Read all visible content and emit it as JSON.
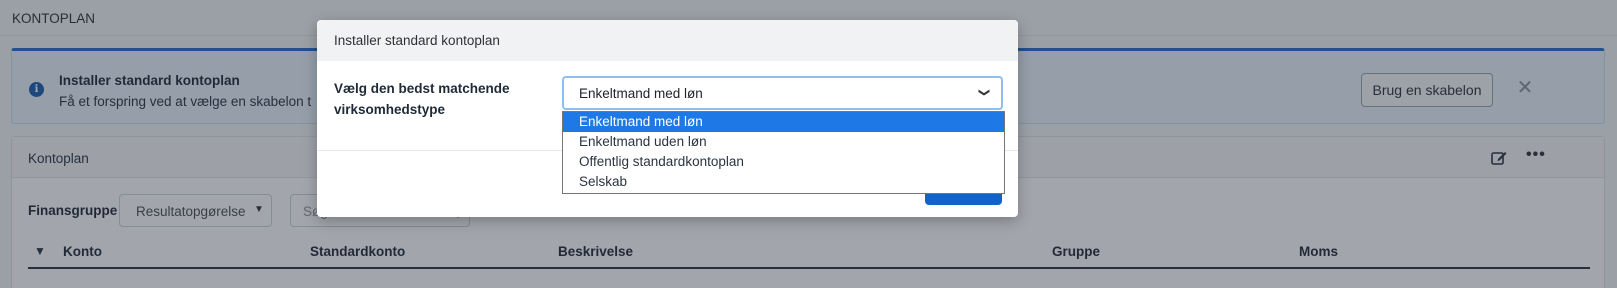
{
  "page": {
    "title": "KONTOPLAN"
  },
  "info": {
    "title": "Installer standard kontoplan",
    "text": "Få et forspring ved at vælge en skabelon t",
    "template_button": "Brug en skabelon",
    "close_glyph": "✕"
  },
  "card": {
    "title": "Kontoplan",
    "filter_label": "Finansgruppe",
    "group_select_value": "Resultatopgørelse",
    "search_placeholder": "Søg",
    "columns": [
      "Konto",
      "Standardkonto",
      "Beskrivelse",
      "Gruppe",
      "Moms"
    ]
  },
  "modal": {
    "title": "Installer standard kontoplan",
    "field_label": "Vælg den bedst matchende virksomhedstype",
    "selected_value": "Enkeltmand med løn",
    "options": [
      "Enkeltmand med løn",
      "Enkeltmand uden løn",
      "Offentlig standardkontoplan",
      "Selskab"
    ]
  },
  "colors": {
    "accent": "#1f6fd1",
    "selected_option": "#1e79e6",
    "primary_button": "#1462c7",
    "info_background": "#e8f3fc"
  },
  "icons": [
    "info-icon",
    "close-icon",
    "edit-icon",
    "more-options-icon",
    "chevron-down-icon",
    "search-icon"
  ]
}
